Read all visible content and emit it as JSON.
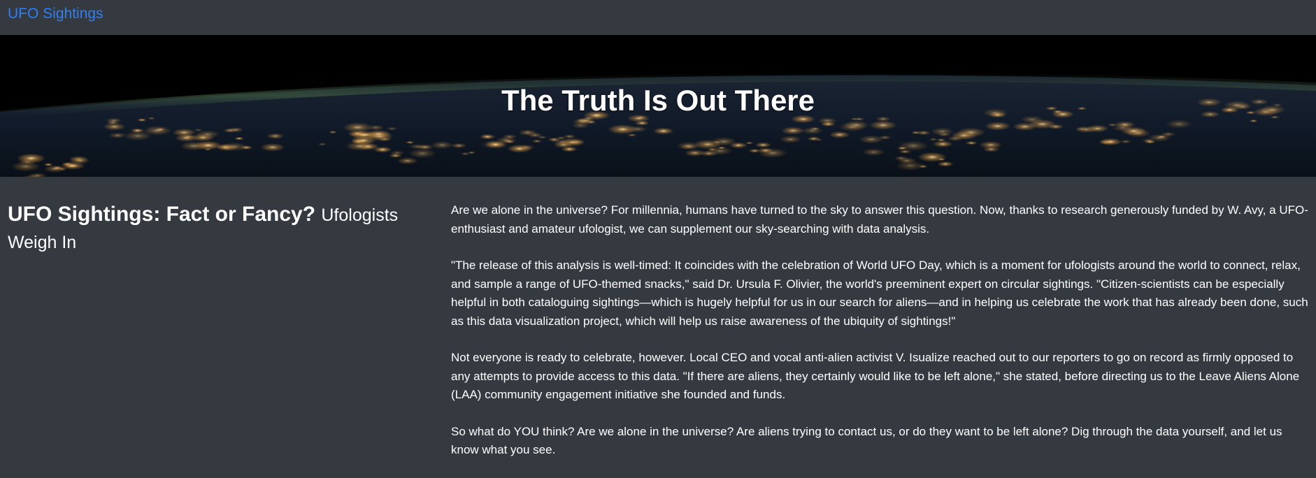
{
  "navbar": {
    "brand": "UFO Sightings"
  },
  "hero": {
    "title": "The Truth Is Out There"
  },
  "headline": {
    "main": "UFO Sightings: Fact or Fancy?",
    "sub": "Ufologists Weigh In"
  },
  "article": {
    "paragraphs": [
      "Are we alone in the universe? For millennia, humans have turned to the sky to answer this question. Now, thanks to research generously funded by W. Avy, a UFO-enthusiast and amateur ufologist, we can supplement our sky-searching with data analysis.",
      "\"The release of this analysis is well-timed: It coincides with the celebration of World UFO Day, which is a moment for ufologists around the world to connect, relax, and sample a range of UFO-themed snacks,\" said Dr. Ursula F. Olivier, the world's preeminent expert on circular sightings. \"Citizen-scientists can be especially helpful in both cataloguing sightings—which is hugely helpful for us in our search for aliens—and in helping us celebrate the work that has already been done, such as this data visualization project, which will help us raise awareness of the ubiquity of sightings!\"",
      "Not everyone is ready to celebrate, however. Local CEO and vocal anti-alien activist V. Isualize reached out to our reporters to go on record as firmly opposed to any attempts to provide access to this data. \"If there are aliens, they certainly would like to be left alone,\" she stated, before directing us to the Leave Aliens Alone (LAA) community engagement initiative she founded and funds.",
      "So what do YOU think? Are we alone in the universe? Are aliens trying to contact us, or do they want to be left alone? Dig through the data yourself, and let us know what you see."
    ]
  },
  "colors": {
    "page_background": "#343a40",
    "brand_link": "#2f7ff6",
    "text": "#ffffff"
  }
}
